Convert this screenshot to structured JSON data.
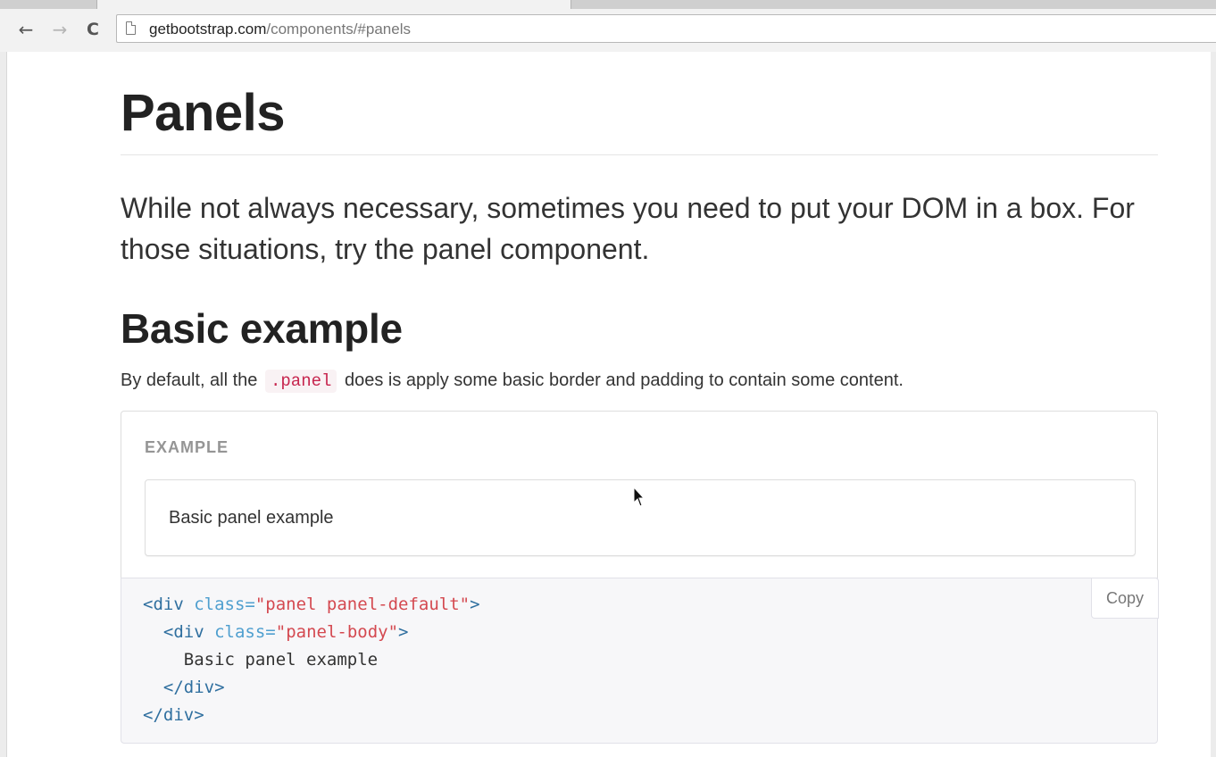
{
  "browser": {
    "url_host": "getbootstrap.com",
    "url_path": "/components/#panels",
    "back_glyph": "←",
    "forward_glyph": "→",
    "reload_glyph": "C"
  },
  "page": {
    "title": "Panels",
    "lead": "While not always necessary, sometimes you need to put your DOM in a box. For those situations, try the panel component.",
    "section_title": "Basic example",
    "section_text_before": "By default, all the",
    "section_code": ".panel",
    "section_text_after": "does is apply some basic border and padding to contain some content.",
    "example_label": "EXAMPLE",
    "demo_panel_text": "Basic panel example",
    "copy_label": "Copy",
    "code_lines": {
      "l1_tag_open": "<div",
      "l1_attr": "class=",
      "l1_str": "\"panel panel-default\"",
      "l1_tag_close": ">",
      "l2_tag_open": "<div",
      "l2_attr": "class=",
      "l2_str": "\"panel-body\"",
      "l2_tag_close": ">",
      "l3_text": "Basic panel example",
      "l4_tag": "</div>",
      "l5_tag": "</div>"
    }
  },
  "colors": {
    "inline_code": "#c7254e",
    "code_tag": "#2f6f9f",
    "code_attr": "#4f9fcf",
    "code_string": "#d44950"
  },
  "icons": {
    "back": "arrow-left-icon",
    "forward": "arrow-right-icon",
    "reload": "reload-icon",
    "page": "page-icon",
    "cursor": "mouse-pointer-icon"
  }
}
